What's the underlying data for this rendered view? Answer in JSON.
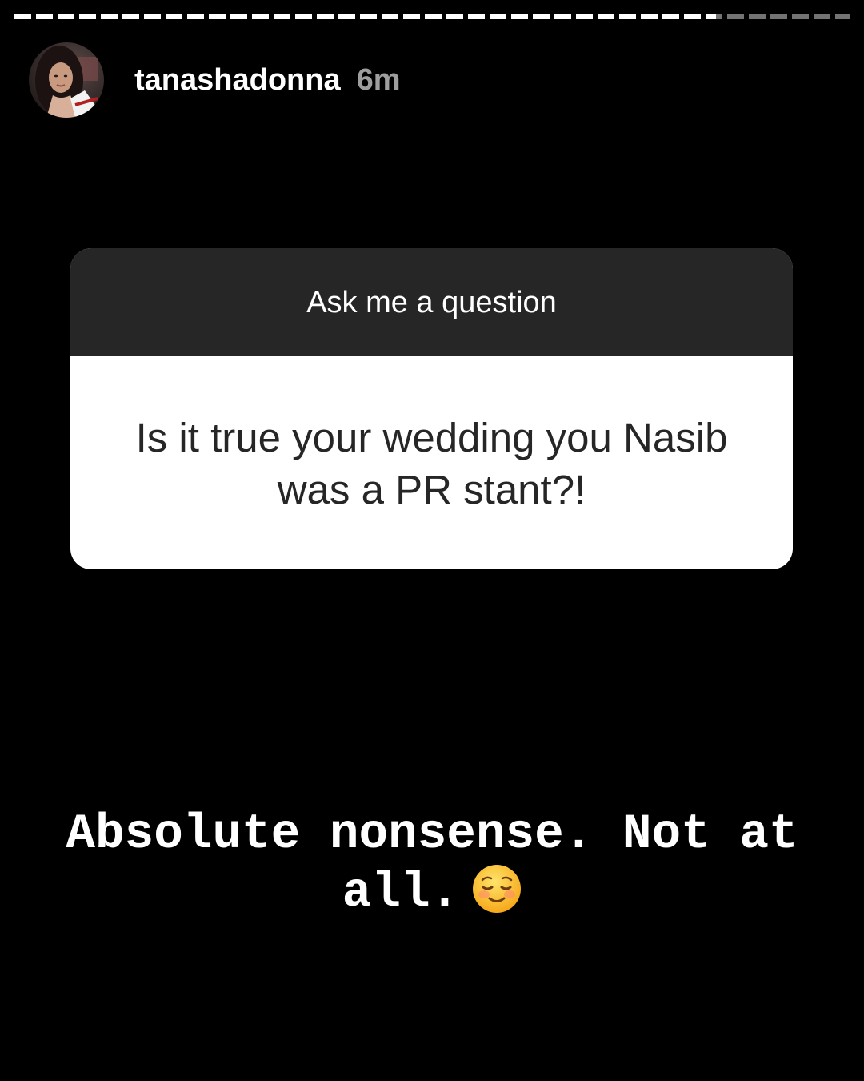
{
  "story": {
    "progress": 0.84,
    "user": {
      "username": "tanashadonna",
      "time_ago": "6m",
      "avatar": "profile-photo"
    }
  },
  "question_sticker": {
    "prompt": "Ask me a question",
    "question": "Is it true your wedding you Nasib was a PR stant?!"
  },
  "answer": {
    "text": "Absolute nonsense. Not at all.",
    "emoji": "smiling-face-emoji"
  },
  "colors": {
    "background": "#000000",
    "sticker_header": "#262626",
    "sticker_body": "#ffffff"
  }
}
